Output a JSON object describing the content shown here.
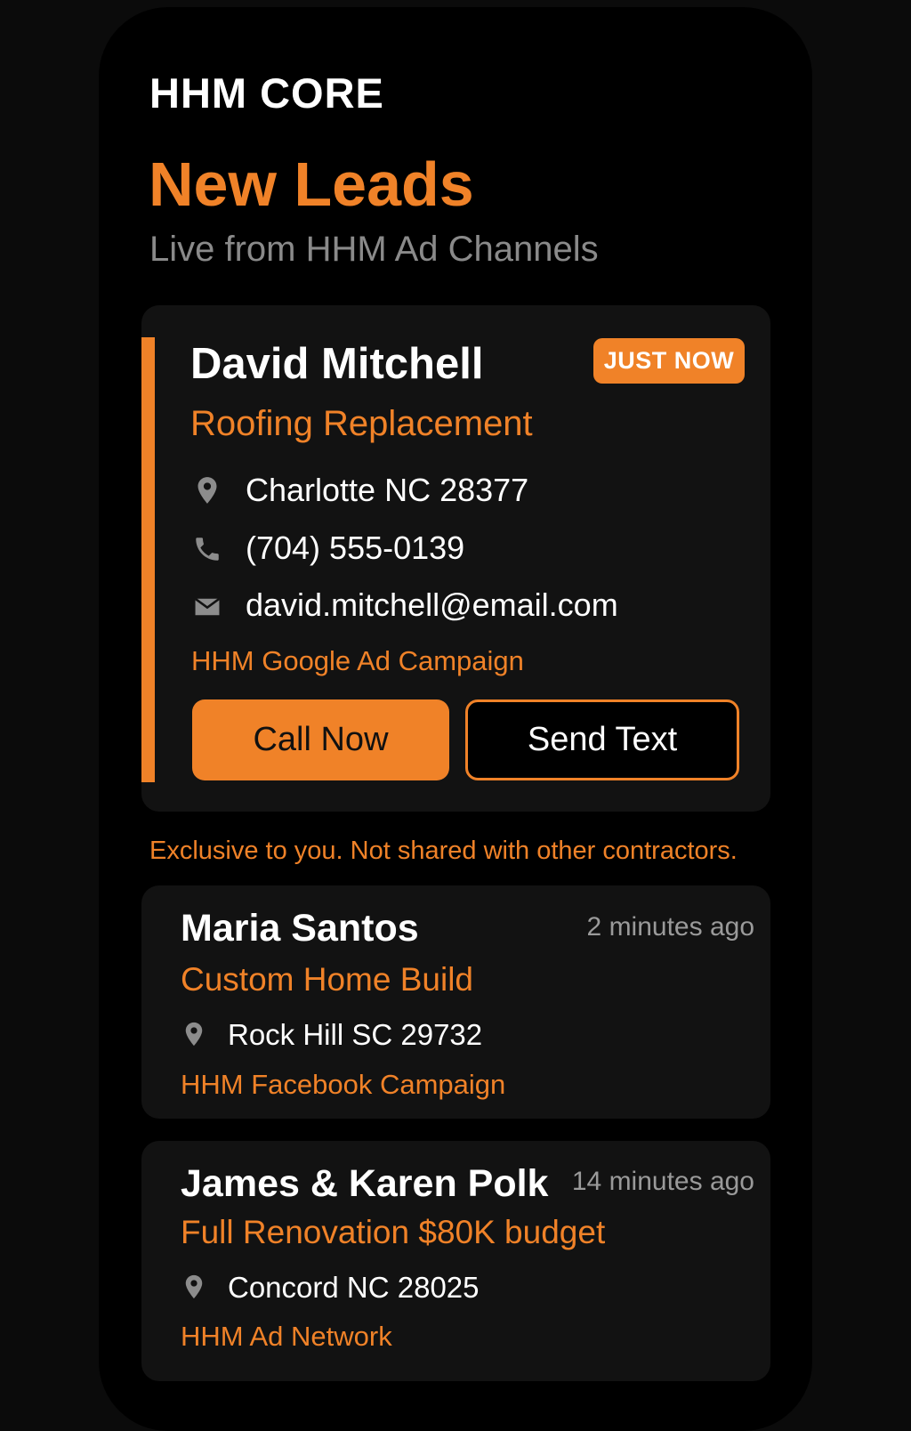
{
  "app": {
    "brand": "HHM CORE",
    "title": "New Leads",
    "subtitle": "Live from HHM Ad Channels"
  },
  "featured_lead": {
    "name": "David Mitchell",
    "badge": "JUST NOW",
    "service": "Roofing Replacement",
    "location": "Charlotte NC 28377",
    "phone": "(704) 555-0139",
    "email": "david.mitchell@email.com",
    "source": "HHM Google Ad Campaign",
    "call_label": "Call Now",
    "text_label": "Send Text"
  },
  "exclusive_note": "Exclusive to you. Not shared with other contractors.",
  "leads": [
    {
      "name": "Maria Santos",
      "time": "2 minutes ago",
      "service": "Custom Home Build",
      "location": "Rock Hill SC 29732",
      "source": "HHM Facebook Campaign"
    },
    {
      "name": "James & Karen Polk",
      "time": "14 minutes ago",
      "service": "Full Renovation $80K budget",
      "location": "Concord NC 28025",
      "source": "HHM Ad Network"
    }
  ],
  "colors": {
    "accent": "#f08228",
    "background": "#000000",
    "card": "#121212",
    "muted": "#8a8a8a",
    "icon": "#8c8c8c"
  },
  "icons": {
    "location": "map-pin-icon",
    "phone": "phone-icon",
    "email": "envelope-icon"
  }
}
